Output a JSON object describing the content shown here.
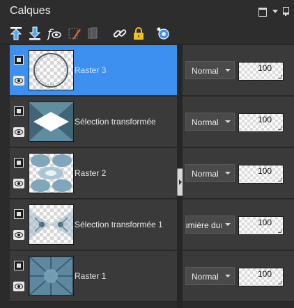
{
  "panel": {
    "title": "Calques",
    "controls": [
      "restore-icon",
      "menu-arrow-icon",
      "pin-icon"
    ]
  },
  "toolbar": {
    "buttons": [
      {
        "icon": "move-layer-up-icon"
      },
      {
        "icon": "move-layer-down-icon"
      },
      {
        "icon": "layer-properties-icon"
      },
      {
        "icon": "edit-selection-icon"
      },
      {
        "icon": "delete-layer-icon"
      },
      {
        "icon": "link-icon"
      },
      {
        "icon": "lock-icon"
      },
      {
        "icon": "mask-icon"
      }
    ]
  },
  "colors": {
    "selected_row": "#3d8ff0",
    "row_bg": "#3a3a3a",
    "panel_bg": "#2b2b2b",
    "accent_icon": "#5ab0ff"
  },
  "layers": [
    {
      "name": "Raster 3",
      "blend_mode": "Normal",
      "opacity": "100",
      "selected": true,
      "thumbnail": "ring"
    },
    {
      "name": "Sélection transformée",
      "blend_mode": "Normal",
      "opacity": "100",
      "selected": false,
      "thumbnail": "bowtie"
    },
    {
      "name": "Raster 2",
      "blend_mode": "Normal",
      "opacity": "100",
      "selected": false,
      "thumbnail": "spheres"
    },
    {
      "name": "Sélection transformée 1",
      "blend_mode": "Lumière dure",
      "blend_mode_visible": "umière dur",
      "opacity": "100",
      "selected": false,
      "thumbnail": "pattern"
    },
    {
      "name": "Raster 1",
      "blend_mode": "Normal",
      "opacity": "100",
      "selected": false,
      "thumbnail": "texture"
    }
  ]
}
